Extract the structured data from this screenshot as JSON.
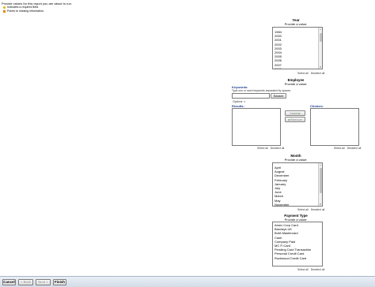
{
  "intro": {
    "text": "Provide values for this report you are about to run.",
    "legend": [
      {
        "icon": "required-icon",
        "text": "Indicates a required field."
      },
      {
        "icon": "missing-info-icon",
        "text": "Points to missing information."
      }
    ]
  },
  "year": {
    "title": "Year",
    "subtitle": "Provide a value:",
    "options": [
      "1984",
      "2000",
      "2001",
      "2002",
      "2003",
      "2004",
      "2005",
      "2006",
      "2007",
      "2008"
    ],
    "select_all": "Select all",
    "deselect_all": "Deselect all"
  },
  "employee": {
    "title": "Employee",
    "subtitle": "Provide a value:",
    "keywords_label": "Keywords:",
    "keywords_hint": "Type one or more keywords separated by spaces.",
    "search_value": "",
    "search_button": "Search",
    "options_link": "Options",
    "results_label": "Results:",
    "choices_label": "Choices:",
    "insert_button": "Insert",
    "remove_button": "Remove",
    "select_all": "Select all",
    "deselect_all": "Deselect all"
  },
  "month": {
    "title": "Month",
    "subtitle": "Provide a value:",
    "options": [
      "April",
      "August",
      "December",
      "February",
      "January",
      "July",
      "June",
      "March",
      "May",
      "November"
    ],
    "select_all": "Select all",
    "deselect_all": "Deselect all"
  },
  "payment": {
    "title": "Payment Type",
    "subtitle": "Provide a value:",
    "options": [
      "Amex Corp Card",
      "Barclays UK",
      "BofA Mastercard",
      "Cash",
      "Company Paid",
      "MC P-Card",
      "Pending Card Transaction",
      "Personal Credit Card",
      "Rockwood Credit Card"
    ],
    "select_all": "Select all",
    "deselect_all": "Deselect all"
  },
  "footer": {
    "cancel": "Cancel",
    "back": "< Back",
    "next": "Next >",
    "finish": "Finish"
  }
}
